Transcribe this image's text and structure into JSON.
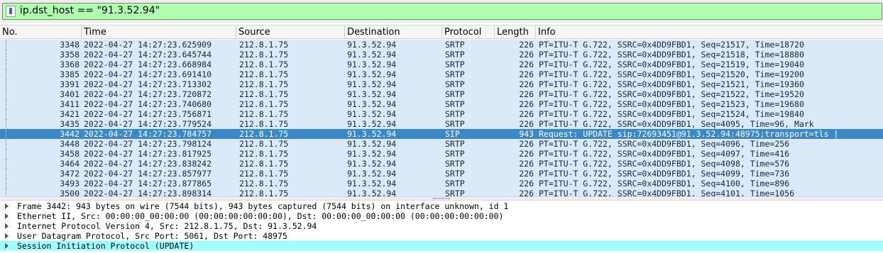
{
  "filter": {
    "value": "ip.dst_host == \"91.3.52.94\"",
    "bookmark_icon": "bookmark-icon"
  },
  "columns": {
    "no": "No.",
    "time": "Time",
    "source": "Source",
    "destination": "Destination",
    "protocol": "Protocol",
    "length": "Length",
    "info": "Info"
  },
  "colors": {
    "row_bg": "#dbeaf9",
    "selected_bg": "#3a88c8",
    "filter_bg": "#afffaf",
    "detail_highlight": "#a0ffff"
  },
  "packets": [
    {
      "no": "3348",
      "time": "2022-04-27 14:27:23.625909",
      "source": "212.8.1.75",
      "destination": "91.3.52.94",
      "protocol": "SRTP",
      "length": "226",
      "info": "PT=ITU-T G.722, SSRC=0x4DD9FBD1, Seq=21517, Time=18720",
      "selected": false
    },
    {
      "no": "3358",
      "time": "2022-04-27 14:27:23.645744",
      "source": "212.8.1.75",
      "destination": "91.3.52.94",
      "protocol": "SRTP",
      "length": "226",
      "info": "PT=ITU-T G.722, SSRC=0x4DD9FBD1, Seq=21518, Time=18880",
      "selected": false
    },
    {
      "no": "3368",
      "time": "2022-04-27 14:27:23.668984",
      "source": "212.8.1.75",
      "destination": "91.3.52.94",
      "protocol": "SRTP",
      "length": "226",
      "info": "PT=ITU-T G.722, SSRC=0x4DD9FBD1, Seq=21519, Time=19040",
      "selected": false
    },
    {
      "no": "3385",
      "time": "2022-04-27 14:27:23.691410",
      "source": "212.8.1.75",
      "destination": "91.3.52.94",
      "protocol": "SRTP",
      "length": "226",
      "info": "PT=ITU-T G.722, SSRC=0x4DD9FBD1, Seq=21520, Time=19200",
      "selected": false
    },
    {
      "no": "3391",
      "time": "2022-04-27 14:27:23.713302",
      "source": "212.8.1.75",
      "destination": "91.3.52.94",
      "protocol": "SRTP",
      "length": "226",
      "info": "PT=ITU-T G.722, SSRC=0x4DD9FBD1, Seq=21521, Time=19360",
      "selected": false
    },
    {
      "no": "3401",
      "time": "2022-04-27 14:27:23.720872",
      "source": "212.8.1.75",
      "destination": "91.3.52.94",
      "protocol": "SRTP",
      "length": "226",
      "info": "PT=ITU-T G.722, SSRC=0x4DD9FBD1, Seq=21522, Time=19520",
      "selected": false
    },
    {
      "no": "3411",
      "time": "2022-04-27 14:27:23.740680",
      "source": "212.8.1.75",
      "destination": "91.3.52.94",
      "protocol": "SRTP",
      "length": "226",
      "info": "PT=ITU-T G.722, SSRC=0x4DD9FBD1, Seq=21523, Time=19680",
      "selected": false
    },
    {
      "no": "3421",
      "time": "2022-04-27 14:27:23.756871",
      "source": "212.8.1.75",
      "destination": "91.3.52.94",
      "protocol": "SRTP",
      "length": "226",
      "info": "PT=ITU-T G.722, SSRC=0x4DD9FBD1, Seq=21524, Time=19840",
      "selected": false
    },
    {
      "no": "3435",
      "time": "2022-04-27 14:27:23.779524",
      "source": "212.8.1.75",
      "destination": "91.3.52.94",
      "protocol": "SRTP",
      "length": "226",
      "info": "PT=ITU-T G.722, SSRC=0x4DD9FBD1, Seq=4095, Time=96, Mark",
      "selected": false
    },
    {
      "no": "3442",
      "time": "2022-04-27 14:27:23.784757",
      "source": "212.8.1.75",
      "destination": "91.3.52.94",
      "protocol": "SIP",
      "length": "943",
      "info": "Request: UPDATE sip:72693451@91.3.52.94:48975;transport=tls |",
      "selected": true
    },
    {
      "no": "3448",
      "time": "2022-04-27 14:27:23.798124",
      "source": "212.8.1.75",
      "destination": "91.3.52.94",
      "protocol": "SRTP",
      "length": "226",
      "info": "PT=ITU-T G.722, SSRC=0x4DD9FBD1, Seq=4096, Time=256",
      "selected": false
    },
    {
      "no": "3458",
      "time": "2022-04-27 14:27:23.817925",
      "source": "212.8.1.75",
      "destination": "91.3.52.94",
      "protocol": "SRTP",
      "length": "226",
      "info": "PT=ITU-T G.722, SSRC=0x4DD9FBD1, Seq=4097, Time=416",
      "selected": false
    },
    {
      "no": "3464",
      "time": "2022-04-27 14:27:23.838242",
      "source": "212.8.1.75",
      "destination": "91.3.52.94",
      "protocol": "SRTP",
      "length": "226",
      "info": "PT=ITU-T G.722, SSRC=0x4DD9FBD1, Seq=4098, Time=576",
      "selected": false
    },
    {
      "no": "3472",
      "time": "2022-04-27 14:27:23.857977",
      "source": "212.8.1.75",
      "destination": "91.3.52.94",
      "protocol": "SRTP",
      "length": "226",
      "info": "PT=ITU-T G.722, SSRC=0x4DD9FBD1, Seq=4099, Time=736",
      "selected": false
    },
    {
      "no": "3493",
      "time": "2022-04-27 14:27:23.877865",
      "source": "212.8.1.75",
      "destination": "91.3.52.94",
      "protocol": "SRTP",
      "length": "226",
      "info": "PT=ITU-T G.722, SSRC=0x4DD9FBD1, Seq=4100, Time=896",
      "selected": false
    },
    {
      "no": "3500",
      "time": "2022-04-27 14:27:23.898314",
      "source": "212.8.1.75",
      "destination": "91.3.52.94",
      "protocol": "SRTP",
      "length": "226",
      "info": "PT=ITU-T G.722, SSRC=0x4DD9FBD1, Seq=4101, Time=1056",
      "selected": false
    }
  ],
  "details": [
    {
      "text": "Frame 3442: 943 bytes on wire (7544 bits), 943 bytes captured (7544 bits) on interface unknown, id 1",
      "highlight": false
    },
    {
      "text": "Ethernet II, Src: 00:00:00_00:00:00 (00:00:00:00:00:00), Dst: 00:00:00_00:00:00 (00:00:00:00:00:00)",
      "highlight": false
    },
    {
      "text": "Internet Protocol Version 4, Src: 212.8.1.75, Dst: 91.3.52.94",
      "highlight": false
    },
    {
      "text": "User Datagram Protocol, Src Port: 5061, Dst Port: 48975",
      "highlight": false
    },
    {
      "text": "Session Initiation Protocol (UPDATE)",
      "highlight": true
    }
  ]
}
